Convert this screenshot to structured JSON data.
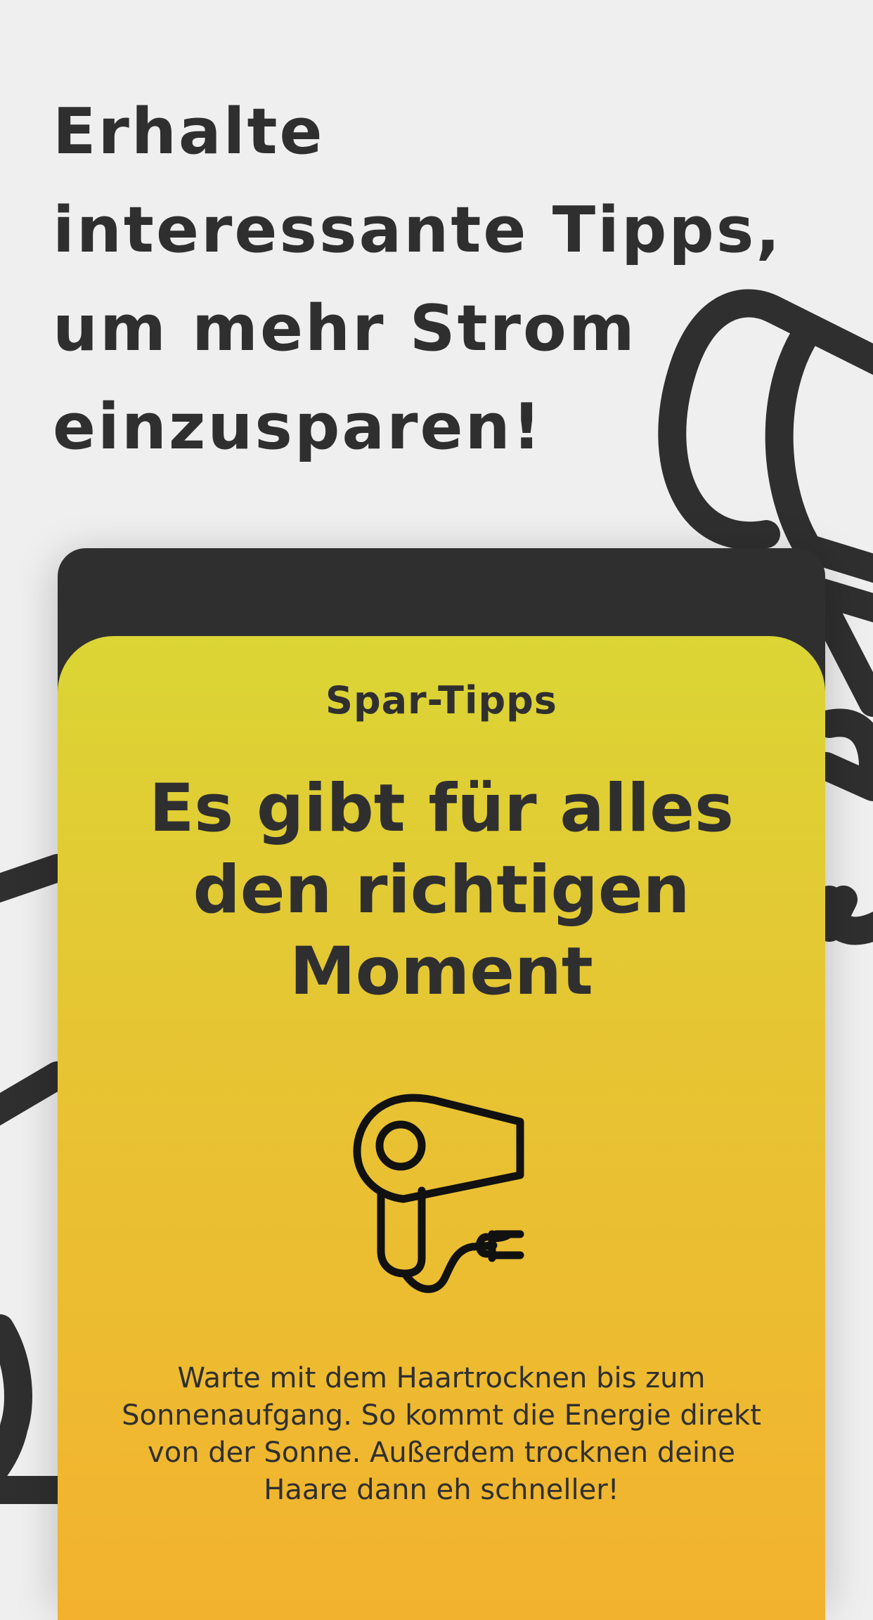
{
  "headline": "Erhalte interessante Tipps, um mehr Strom einzusparen!",
  "card": {
    "label": "Spar-Tipps",
    "title": "Es gibt für alles den richtigen Moment",
    "icon": "hair-dryer-icon",
    "body": "Warte mit dem Haartrocknen bis zum Sonnenaufgang. So kommt die Energie direkt von der Sonne. Außerdem trocknen deine Haare dann eh schneller!"
  },
  "colors": {
    "background": "#efefef",
    "dark": "#2f2f2f",
    "card_gradient_top": "#dbd535",
    "card_gradient_bottom": "#f3b22e"
  }
}
